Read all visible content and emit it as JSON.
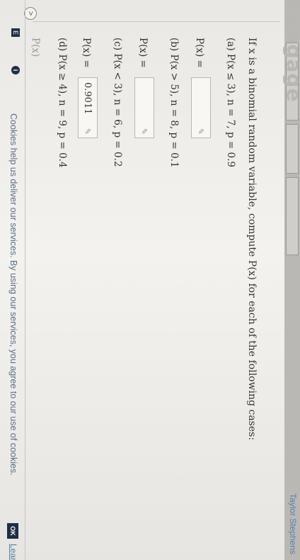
{
  "header": {
    "logo_text": "Cengage",
    "user_name": "Taylor Stephens",
    "tabs": [
      "",
      "",
      ""
    ]
  },
  "nav": {
    "back_symbol": ">",
    "square_badge": "E",
    "info_badge": "i"
  },
  "question": {
    "intro": "If x is a binomial random variable, compute P(x) for each of the following cases:",
    "parts": [
      {
        "label": "(a)",
        "text": "P(x ≤ 3), n = 7, p = 0.9",
        "answer_label": "P(x) =",
        "answer": ""
      },
      {
        "label": "(b)",
        "text": "P(x > 5), n = 8, p = 0.1",
        "answer_label": "P(x) =",
        "answer": ""
      },
      {
        "label": "(c)",
        "text": "P(x < 3), n = 6, p = 0.2",
        "answer_label": "P(x) =",
        "answer": "0.9011"
      },
      {
        "label": "(d)",
        "text": "P(x ≥ 4), n = 9, p = 0.4",
        "answer_label": "P(x) =",
        "answer": ""
      }
    ],
    "truncated_label": "P(x)"
  },
  "cookie_bar": {
    "text": "Cookies help us deliver our services. By using our services, you agree to our use of cookies.",
    "ok_label": "OK",
    "learn_more_label": "Learn more"
  }
}
